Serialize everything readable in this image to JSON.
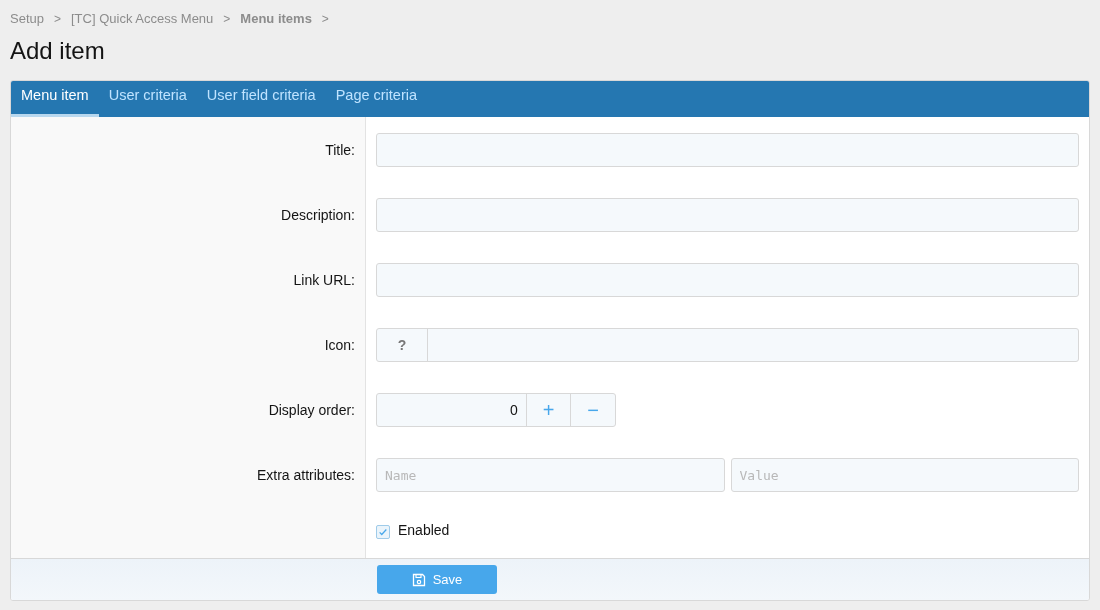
{
  "breadcrumb": [
    {
      "text": "Setup",
      "bold": false,
      "separator": ">"
    },
    {
      "text": "[TC] Quick Access Menu",
      "bold": false,
      "separator": ">"
    },
    {
      "text": "Menu items",
      "bold": true,
      "separator": ">"
    }
  ],
  "title": "Add item",
  "tabs": [
    {
      "label": "Menu item",
      "selected": true
    },
    {
      "label": "User criteria",
      "selected": false
    },
    {
      "label": "User field criteria",
      "selected": false
    },
    {
      "label": "Page criteria",
      "selected": false
    }
  ],
  "rows": [
    {
      "kind": "text",
      "label": "Title:"
    },
    {
      "kind": "text",
      "label": "Description:"
    },
    {
      "kind": "text",
      "label": "Link URL:"
    },
    {
      "kind": "icon",
      "label": "Icon:",
      "button": "?"
    },
    {
      "kind": "number",
      "label": "Display order:",
      "value": "0",
      "plus": "+",
      "minus": "−"
    },
    {
      "kind": "pair",
      "label": "Extra attributes:",
      "placeholders": [
        "Name",
        "Value"
      ]
    },
    {
      "kind": "checkbox",
      "text": "Enabled",
      "checked": true
    }
  ],
  "save_button": "Save"
}
